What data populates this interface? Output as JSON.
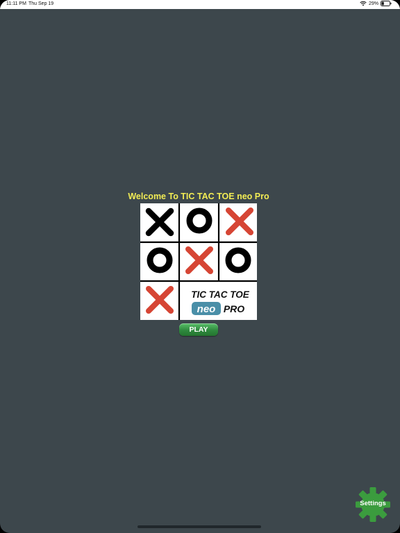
{
  "status_bar": {
    "time": "11:11 PM",
    "date": "Thu Sep 19",
    "battery": "29%",
    "battery_level": 0.29
  },
  "welcome": {
    "title": "Welcome To TIC TAC TOE neo Pro"
  },
  "logo": {
    "cells": [
      "X",
      "O",
      "X-red",
      "O",
      "X-red",
      "O",
      "X-red"
    ],
    "line1": "TIC TAC TOE",
    "badge": "neo",
    "line2": "PRO"
  },
  "play_button": {
    "label": "PLAY"
  },
  "settings_button": {
    "label": "Settings"
  },
  "colors": {
    "background": "#3d474c",
    "title": "#f2ec54",
    "x_black": "#000000",
    "x_red": "#d64534",
    "o_black": "#000000",
    "badge": "#4a8fa8",
    "play_green": "#2f8a3e",
    "settings_green": "#3b9c3e"
  }
}
